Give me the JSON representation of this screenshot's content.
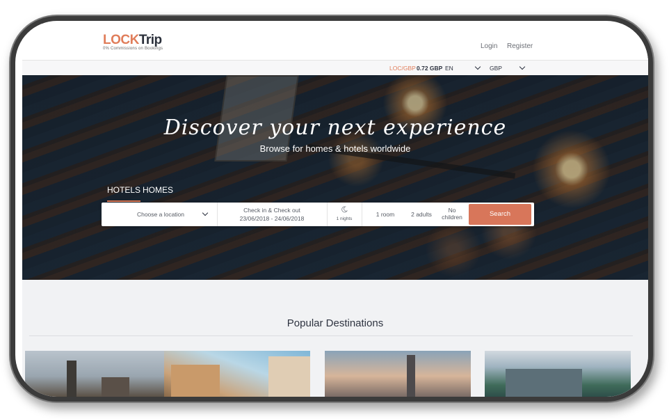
{
  "brand": {
    "logo_lock": "LOCK",
    "logo_trip": "Trip",
    "tagline": "0% Commissions on Bookings"
  },
  "nav": {
    "login": "Login",
    "register": "Register"
  },
  "subbar": {
    "rate_label": "LOC/GBP",
    "rate_value": "0.72 GBP",
    "language": "EN",
    "currency": "GBP"
  },
  "hero": {
    "title": "Discover your next experience",
    "subtitle": "Browse for homes & hotels worldwide",
    "tabs": [
      {
        "label": "HOTELS",
        "active": true
      },
      {
        "label": "HOMES",
        "active": false
      }
    ]
  },
  "search": {
    "location_placeholder": "Choose a location",
    "dates_label": "Check in & Check out",
    "dates_value": "23/06/2018 - 24/06/2018",
    "nights": "1 nights",
    "rooms": "1 room",
    "adults": "2 adults",
    "children": "No children",
    "button": "Search"
  },
  "destinations": {
    "title": "Popular Destinations"
  },
  "colors": {
    "accent": "#e07d5a",
    "search_button": "#d8765a",
    "dark_text": "#2e3340"
  },
  "icons": [
    "moon-icon",
    "chevron-down-icon"
  ]
}
